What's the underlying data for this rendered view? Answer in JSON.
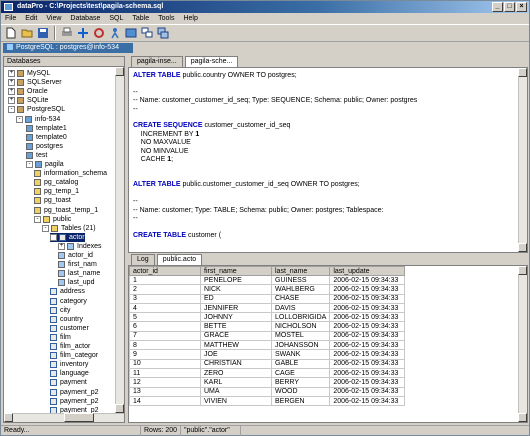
{
  "window": {
    "title": "dataPro - C:\\Projects\\test\\pagila-schema.sql"
  },
  "menu": [
    "File",
    "Edit",
    "View",
    "Database",
    "SQL",
    "Table",
    "Tools",
    "Help"
  ],
  "connection": {
    "label": "PostgreSQL : postgres@info-534"
  },
  "left_panel": {
    "header": "Databases"
  },
  "tree": [
    {
      "label": "MySQL",
      "icon": "db"
    },
    {
      "label": "SQLServer",
      "icon": "db"
    },
    {
      "label": "Oracle",
      "icon": "db"
    },
    {
      "label": "SQLite",
      "icon": "db"
    },
    {
      "label": "PostgreSQL",
      "icon": "db"
    },
    {
      "label": "info-534",
      "icon": "pg"
    },
    {
      "label": "template1",
      "icon": "pg"
    },
    {
      "label": "template0",
      "icon": "pg"
    },
    {
      "label": "postgres",
      "icon": "pg"
    },
    {
      "label": "test",
      "icon": "pg"
    },
    {
      "label": "pagila",
      "icon": "pg"
    },
    {
      "label": "information_schema",
      "icon": "grp"
    },
    {
      "label": "pg_catalog",
      "icon": "grp"
    },
    {
      "label": "pg_temp_1",
      "icon": "grp"
    },
    {
      "label": "pg_toast",
      "icon": "grp"
    },
    {
      "label": "pg_toast_temp_1",
      "icon": "grp"
    },
    {
      "label": "public",
      "icon": "grp"
    },
    {
      "label": "Tables (21)",
      "icon": "grp"
    },
    {
      "label": "actor",
      "icon": "tbl"
    },
    {
      "label": "Indexes",
      "icon": "col"
    },
    {
      "label": "actor_id",
      "icon": "col"
    },
    {
      "label": "first_nam",
      "icon": "col"
    },
    {
      "label": "last_name",
      "icon": "col"
    },
    {
      "label": "last_upd",
      "icon": "col"
    },
    {
      "label": "address",
      "icon": "tbl"
    },
    {
      "label": "category",
      "icon": "tbl"
    },
    {
      "label": "city",
      "icon": "tbl"
    },
    {
      "label": "country",
      "icon": "tbl"
    },
    {
      "label": "customer",
      "icon": "tbl"
    },
    {
      "label": "film",
      "icon": "tbl"
    },
    {
      "label": "film_actor",
      "icon": "tbl"
    },
    {
      "label": "film_categor",
      "icon": "tbl"
    },
    {
      "label": "inventory",
      "icon": "tbl"
    },
    {
      "label": "language",
      "icon": "tbl"
    },
    {
      "label": "payment",
      "icon": "tbl"
    },
    {
      "label": "payment_p2",
      "icon": "tbl"
    },
    {
      "label": "payment_p2",
      "icon": "tbl"
    },
    {
      "label": "payment_p2",
      "icon": "tbl"
    }
  ],
  "editor_tabs": [
    "pagila-inse...",
    "pagila-sche..."
  ],
  "code_lines": [
    [
      [
        "kw",
        "ALTER TABLE"
      ],
      [
        "t",
        " public.country OWNER TO postgres;"
      ]
    ],
    [
      [
        "t",
        ""
      ]
    ],
    [
      [
        "t",
        "--"
      ]
    ],
    [
      [
        "t",
        "-- Name: customer_customer_id_seq; Type: SEQUENCE; Schema: public; Owner: postgres"
      ]
    ],
    [
      [
        "t",
        "--"
      ]
    ],
    [
      [
        "t",
        ""
      ]
    ],
    [
      [
        "kw",
        "CREATE SEQUENCE"
      ],
      [
        "t",
        " customer_customer_id_seq"
      ]
    ],
    [
      [
        "t",
        "    INCREMENT BY "
      ],
      [
        "num",
        "1"
      ]
    ],
    [
      [
        "t",
        "    NO MAXVALUE"
      ]
    ],
    [
      [
        "t",
        "    NO MINVALUE"
      ]
    ],
    [
      [
        "t",
        "    CACHE "
      ],
      [
        "num",
        "1"
      ],
      [
        "t",
        ";"
      ]
    ],
    [
      [
        "t",
        ""
      ]
    ],
    [
      [
        "t",
        ""
      ]
    ],
    [
      [
        "kw",
        "ALTER TABLE"
      ],
      [
        "t",
        " public.customer_customer_id_seq OWNER TO postgres;"
      ]
    ],
    [
      [
        "t",
        ""
      ]
    ],
    [
      [
        "t",
        "--"
      ]
    ],
    [
      [
        "t",
        "-- Name: customer; Type: TABLE; Schema: public; Owner: postgres; Tablespace:"
      ]
    ],
    [
      [
        "t",
        "--"
      ]
    ],
    [
      [
        "t",
        ""
      ]
    ],
    [
      [
        "kw",
        "CREATE TABLE"
      ],
      [
        "t",
        " customer ("
      ]
    ]
  ],
  "grid_tabs": [
    "Log",
    "public.acto"
  ],
  "grid": {
    "columns": [
      "actor_id",
      "first_name",
      "last_name",
      "last_update"
    ],
    "rows": [
      [
        "1",
        "PENELOPE",
        "GUINESS",
        "2006-02-15 09:34:33"
      ],
      [
        "2",
        "NICK",
        "WAHLBERG",
        "2006-02-15 09:34:33"
      ],
      [
        "3",
        "ED",
        "CHASE",
        "2006-02-15 09:34:33"
      ],
      [
        "4",
        "JENNIFER",
        "DAVIS",
        "2006-02-15 09:34:33"
      ],
      [
        "5",
        "JOHNNY",
        "LOLLOBRIGIDA",
        "2006-02-15 09:34:33"
      ],
      [
        "6",
        "BETTE",
        "NICHOLSON",
        "2006-02-15 09:34:33"
      ],
      [
        "7",
        "GRACE",
        "MOSTEL",
        "2006-02-15 09:34:33"
      ],
      [
        "8",
        "MATTHEW",
        "JOHANSSON",
        "2006-02-15 09:34:33"
      ],
      [
        "9",
        "JOE",
        "SWANK",
        "2006-02-15 09:34:33"
      ],
      [
        "10",
        "CHRISTIAN",
        "GABLE",
        "2006-02-15 09:34:33"
      ],
      [
        "11",
        "ZERO",
        "CAGE",
        "2006-02-15 09:34:33"
      ],
      [
        "12",
        "KARL",
        "BERRY",
        "2006-02-15 09:34:33"
      ],
      [
        "13",
        "UMA",
        "WOOD",
        "2006-02-15 09:34:33"
      ],
      [
        "14",
        "VIVIEN",
        "BERGEN",
        "2006-02-15 09:34:33"
      ]
    ]
  },
  "status": {
    "left": "Ready...",
    "rows": "Rows: 200",
    "table": "\"public\".\"actor\""
  },
  "colors": {
    "titlebar": "#0a246a",
    "selection": "#0a246a",
    "keyword": "#0000c0"
  },
  "toolbar_icons": [
    "new-file-icon",
    "open-folder-icon",
    "save-icon",
    "print-icon",
    "add-icon",
    "refresh-icon",
    "run-icon",
    "connect-icon",
    "windows-icon",
    "cascade-icon"
  ]
}
